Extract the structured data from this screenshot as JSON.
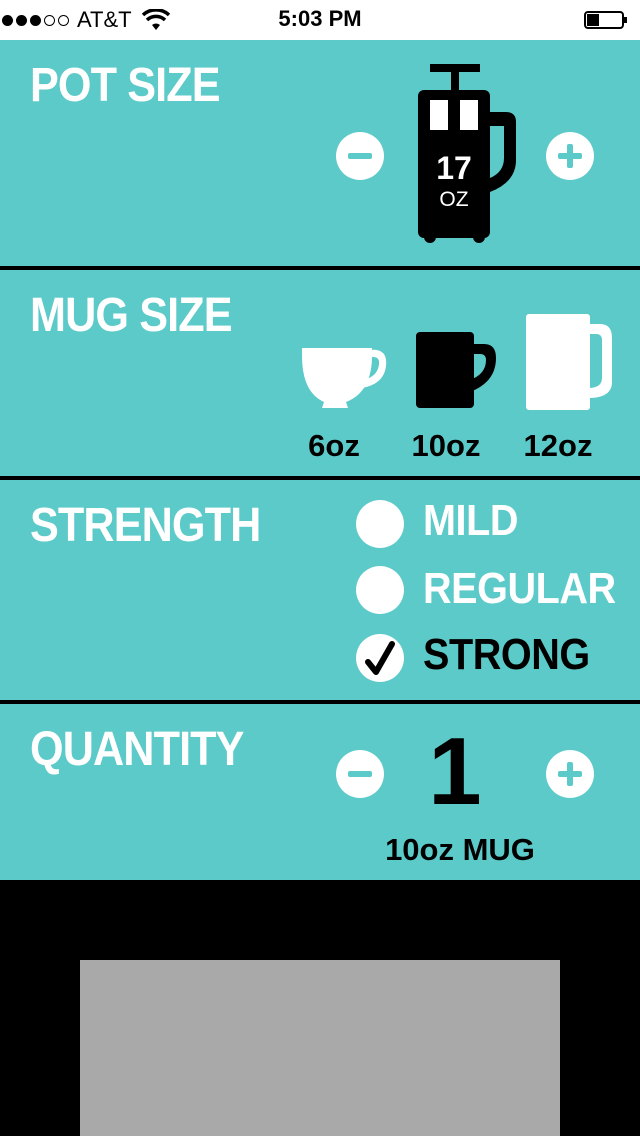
{
  "status_bar": {
    "carrier": "AT&T",
    "time": "5:03 PM",
    "signal_bars_filled": 3,
    "signal_bars_total": 5,
    "battery_level": 0.3
  },
  "pot_size": {
    "title": "POT SIZE",
    "value": "17",
    "unit": "OZ",
    "decrement_icon": "minus-icon",
    "increment_icon": "plus-icon"
  },
  "mug_size": {
    "title": "MUG SIZE",
    "options": [
      {
        "label": "6oz",
        "icon": "cup-icon",
        "selected": false
      },
      {
        "label": "10oz",
        "icon": "mug-icon",
        "selected": true
      },
      {
        "label": "12oz",
        "icon": "tall-mug-icon",
        "selected": false
      }
    ]
  },
  "strength": {
    "title": "STRENGTH",
    "options": [
      {
        "label": "MILD",
        "selected": false
      },
      {
        "label": "REGULAR",
        "selected": false
      },
      {
        "label": "STRONG",
        "selected": true
      }
    ]
  },
  "quantity": {
    "title": "QUANTITY",
    "value": "1",
    "unit_label": "10oz MUG"
  },
  "colors": {
    "panel": "#5ccac9",
    "divider": "#000000",
    "active": "#000000",
    "inactive": "#ffffff"
  }
}
